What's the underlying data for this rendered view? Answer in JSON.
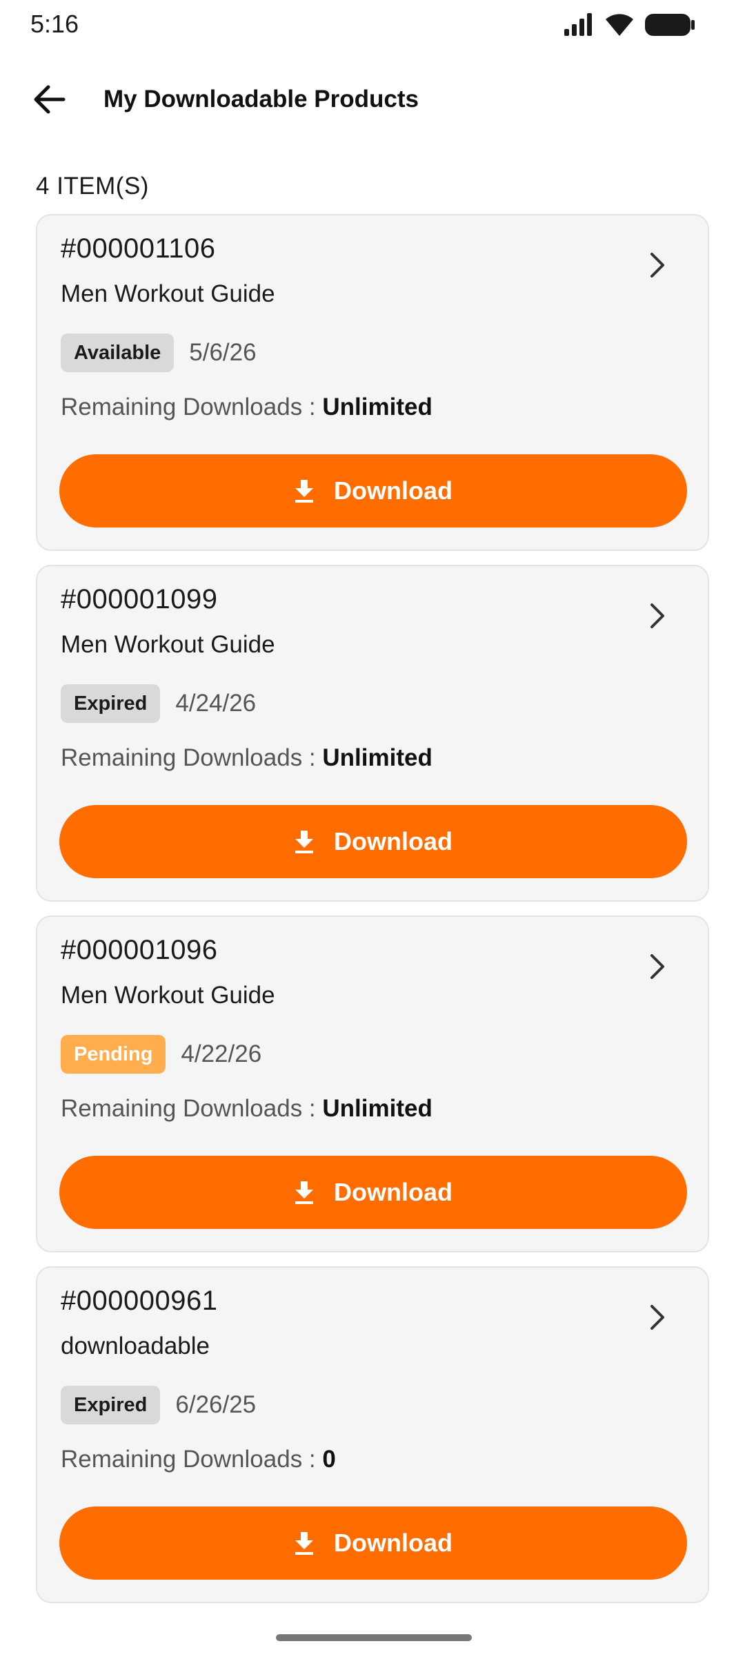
{
  "status_bar": {
    "time": "5:16",
    "icons": [
      "signal-icon",
      "wifi-icon",
      "battery-icon"
    ]
  },
  "header": {
    "back_icon": "arrow-left-icon",
    "title": "My Downloadable Products"
  },
  "list": {
    "count_label": "4 ITEM(S)",
    "remaining_label": "Remaining Downloads : ",
    "download_label": "Download",
    "items": [
      {
        "order_no": "#000001106",
        "product": "Men Workout Guide",
        "status": "Available",
        "date": "5/6/26",
        "remaining": "Unlimited"
      },
      {
        "order_no": "#000001099",
        "product": "Men Workout Guide",
        "status": "Expired",
        "date": "4/24/26",
        "remaining": "Unlimited"
      },
      {
        "order_no": "#000001096",
        "product": "Men Workout Guide",
        "status": "Pending",
        "date": "4/22/26",
        "remaining": "Unlimited"
      },
      {
        "order_no": "#000000961",
        "product": "downloadable",
        "status": "Expired",
        "date": "6/26/25",
        "remaining": "0"
      }
    ]
  },
  "colors": {
    "accent": "#ff6d00",
    "badge_default": "#d9d9d9",
    "badge_pending": "#ffad4d",
    "card_bg": "#f5f5f5"
  }
}
